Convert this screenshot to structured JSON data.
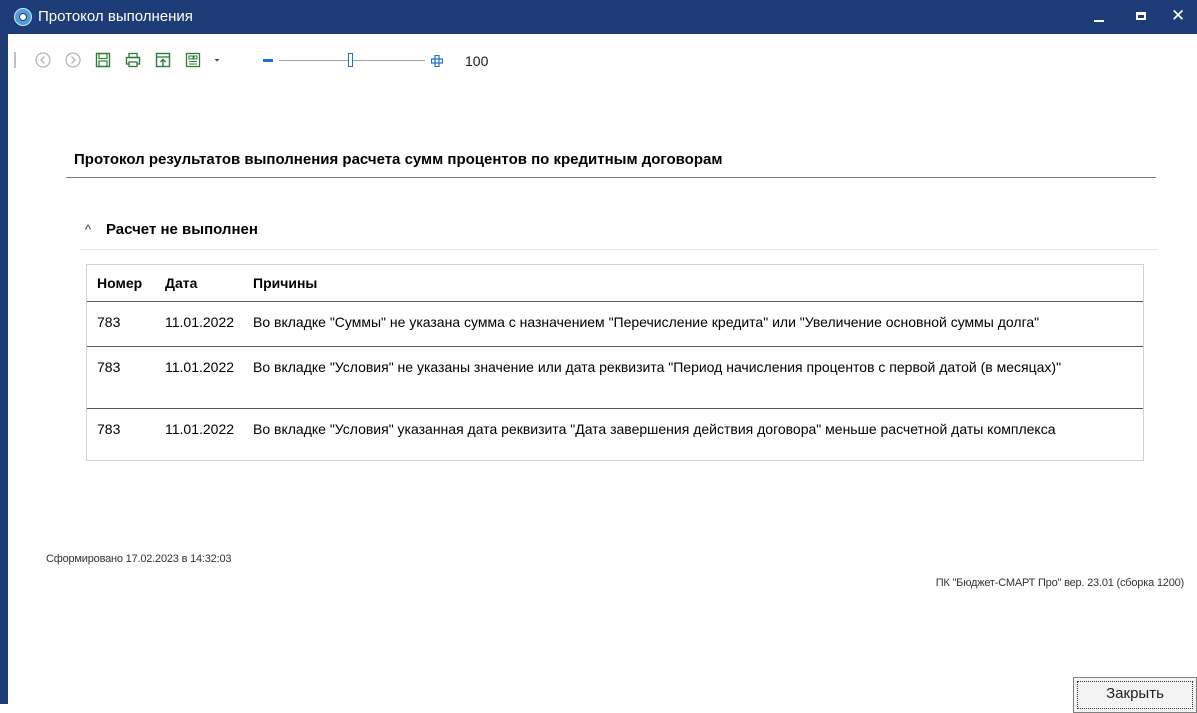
{
  "window": {
    "title": "Протокол выполнения",
    "accent": "#1e3d78"
  },
  "toolbar": {
    "icons": [
      "back-icon",
      "forward-icon",
      "save-icon",
      "print-icon",
      "export-icon",
      "layout-icon",
      "dropdown-arrow-icon",
      "zoom-out-icon",
      "zoom-in-icon"
    ],
    "zoom_value": "100"
  },
  "report": {
    "title": "Протокол результатов выполнения расчета сумм процентов по кредитным договорам",
    "section_title": "Расчет не выполнен",
    "table": {
      "headers": [
        "Номер",
        "Дата",
        "Причины"
      ],
      "rows": [
        [
          "783",
          "11.01.2022",
          "Во вкладке \"Суммы\" не указана сумма с назначением \"Перечисление кредита\" или \"Увеличение основной суммы долга\""
        ],
        [
          "783",
          "11.01.2022",
          "Во вкладке \"Условия\" не указаны значение или дата реквизита \"Период начисления процентов с первой датой (в месяцах)\""
        ],
        [
          "783",
          "11.01.2022",
          "Во вкладке \"Условия\" указанная дата реквизита \"Дата завершения действия договора\" меньше расчетной даты комплекса"
        ]
      ]
    },
    "generated": "Сформировано 17.02.2023 в 14:32:03",
    "version": "ПК \"Бюджет-СМАРТ Про\" вер. 23.01 (сборка 1200)"
  },
  "buttons": {
    "close": "Закрыть"
  }
}
